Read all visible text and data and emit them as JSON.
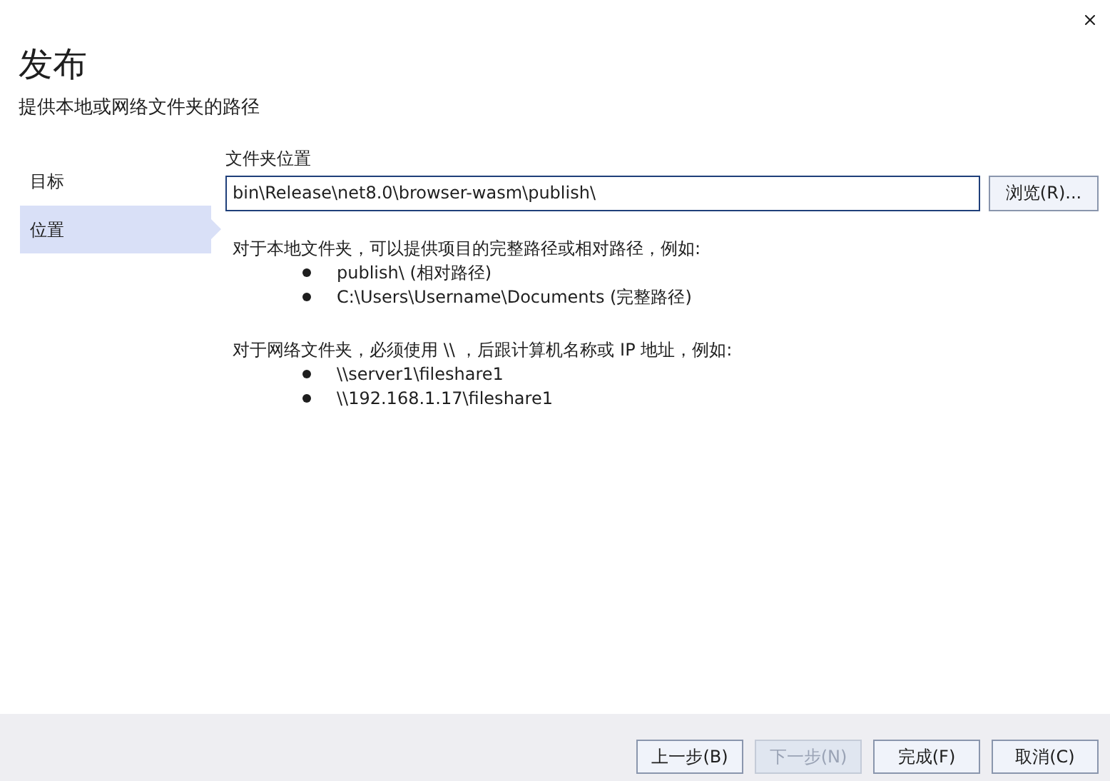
{
  "window": {
    "title": "发布",
    "subtitle": "提供本地或网络文件夹的路径"
  },
  "sidebar": {
    "items": [
      {
        "label": "目标",
        "selected": false
      },
      {
        "label": "位置",
        "selected": true
      }
    ]
  },
  "folder_field": {
    "label": "文件夹位置",
    "value": "bin\\Release\\net8.0\\browser-wasm\\publish\\",
    "browse_button": "浏览(R)..."
  },
  "help": [
    {
      "intro": "对于本地文件夹，可以提供项目的完整路径或相对路径，例如:",
      "examples": [
        "publish\\ (相对路径)",
        "C:\\Users\\Username\\Documents (完整路径)"
      ]
    },
    {
      "intro": "对于网络文件夹，必须使用 \\\\ ，后跟计算机名称或 IP 地址，例如:",
      "examples": [
        "\\\\server1\\fileshare1",
        "\\\\192.168.1.17\\fileshare1"
      ]
    }
  ],
  "buttons": [
    {
      "label": "上一步(B)",
      "disabled": false
    },
    {
      "label": "下一步(N)",
      "disabled": true
    },
    {
      "label": "完成(F)",
      "disabled": false
    },
    {
      "label": "取消(C)",
      "disabled": false
    }
  ]
}
